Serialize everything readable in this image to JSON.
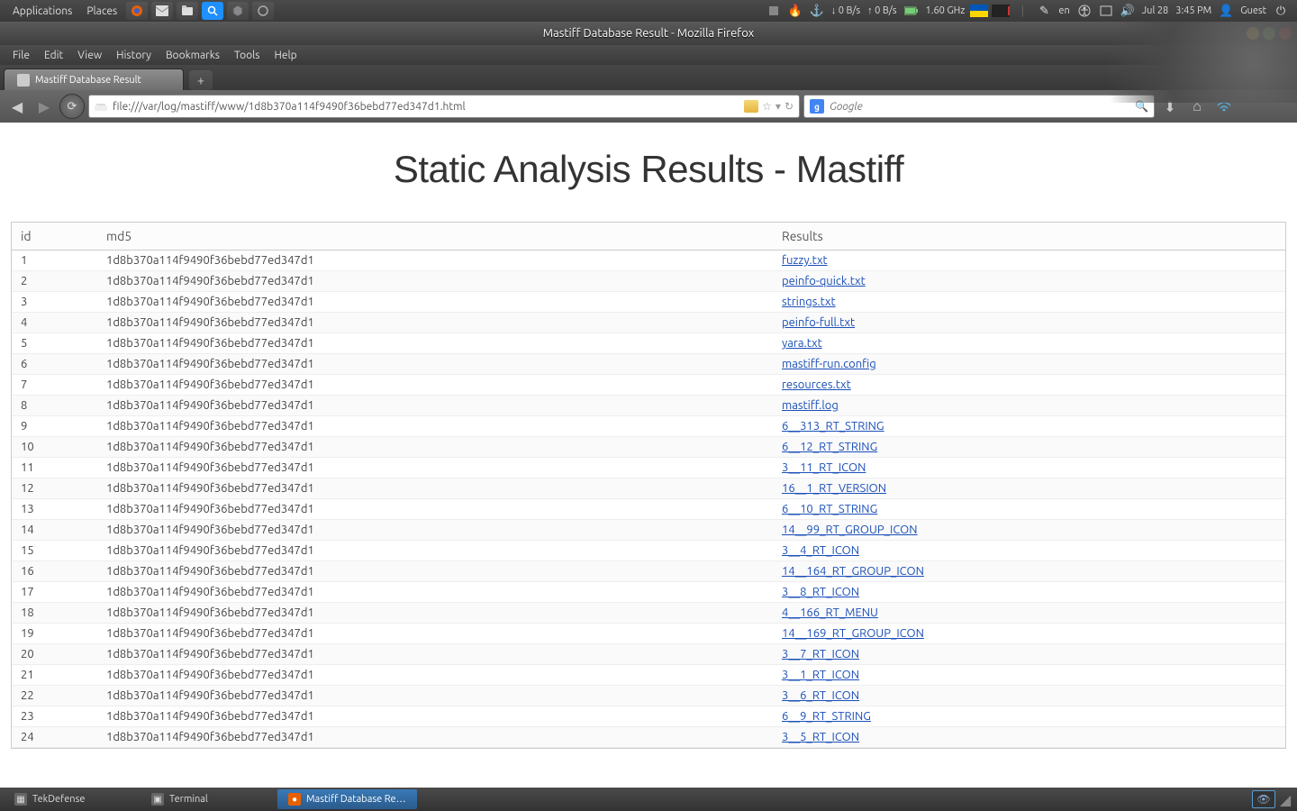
{
  "gnome": {
    "applications": "Applications",
    "places": "Places",
    "net_down": "0 B/s",
    "net_up": "0 B/s",
    "cpu": "1.60 GHz",
    "lang": "en",
    "date": "Jul 28",
    "time": "3:45 PM",
    "user": "Guest"
  },
  "titlebar": {
    "text": "Mastiff Database Result - Mozilla Firefox"
  },
  "menubar": {
    "file": "File",
    "edit": "Edit",
    "view": "View",
    "history": "History",
    "bookmarks": "Bookmarks",
    "tools": "Tools",
    "help": "Help"
  },
  "tab": {
    "label": "Mastiff Database Result"
  },
  "urlbar": {
    "value": "file:///var/log/mastiff/www/1d8b370a114f9490f36bebd77ed347d1.html"
  },
  "searchbar": {
    "placeholder": "Google"
  },
  "page": {
    "title": "Static Analysis Results - Mastiff",
    "headers": {
      "id": "id",
      "md5": "md5",
      "results": "Results"
    },
    "md5": "1d8b370a114f9490f36bebd77ed347d1",
    "rows": [
      {
        "id": "1",
        "result": "fuzzy.txt"
      },
      {
        "id": "2",
        "result": "peinfo-quick.txt"
      },
      {
        "id": "3",
        "result": "strings.txt"
      },
      {
        "id": "4",
        "result": "peinfo-full.txt"
      },
      {
        "id": "5",
        "result": "yara.txt"
      },
      {
        "id": "6",
        "result": "mastiff-run.config"
      },
      {
        "id": "7",
        "result": "resources.txt"
      },
      {
        "id": "8",
        "result": "mastiff.log"
      },
      {
        "id": "9",
        "result": "6__313_RT_STRING"
      },
      {
        "id": "10",
        "result": "6__12_RT_STRING"
      },
      {
        "id": "11",
        "result": "3__11_RT_ICON"
      },
      {
        "id": "12",
        "result": "16__1_RT_VERSION"
      },
      {
        "id": "13",
        "result": "6__10_RT_STRING"
      },
      {
        "id": "14",
        "result": "14__99_RT_GROUP_ICON"
      },
      {
        "id": "15",
        "result": "3__4_RT_ICON"
      },
      {
        "id": "16",
        "result": "14__164_RT_GROUP_ICON"
      },
      {
        "id": "17",
        "result": "3__8_RT_ICON"
      },
      {
        "id": "18",
        "result": "4__166_RT_MENU"
      },
      {
        "id": "19",
        "result": "14__169_RT_GROUP_ICON"
      },
      {
        "id": "20",
        "result": "3__7_RT_ICON"
      },
      {
        "id": "21",
        "result": "3__1_RT_ICON"
      },
      {
        "id": "22",
        "result": "3__6_RT_ICON"
      },
      {
        "id": "23",
        "result": "6__9_RT_STRING"
      },
      {
        "id": "24",
        "result": "3__5_RT_ICON"
      }
    ]
  },
  "taskbar": {
    "items": [
      {
        "label": "TekDefense"
      },
      {
        "label": "Terminal"
      },
      {
        "label": "Mastiff Database Re…"
      }
    ]
  }
}
